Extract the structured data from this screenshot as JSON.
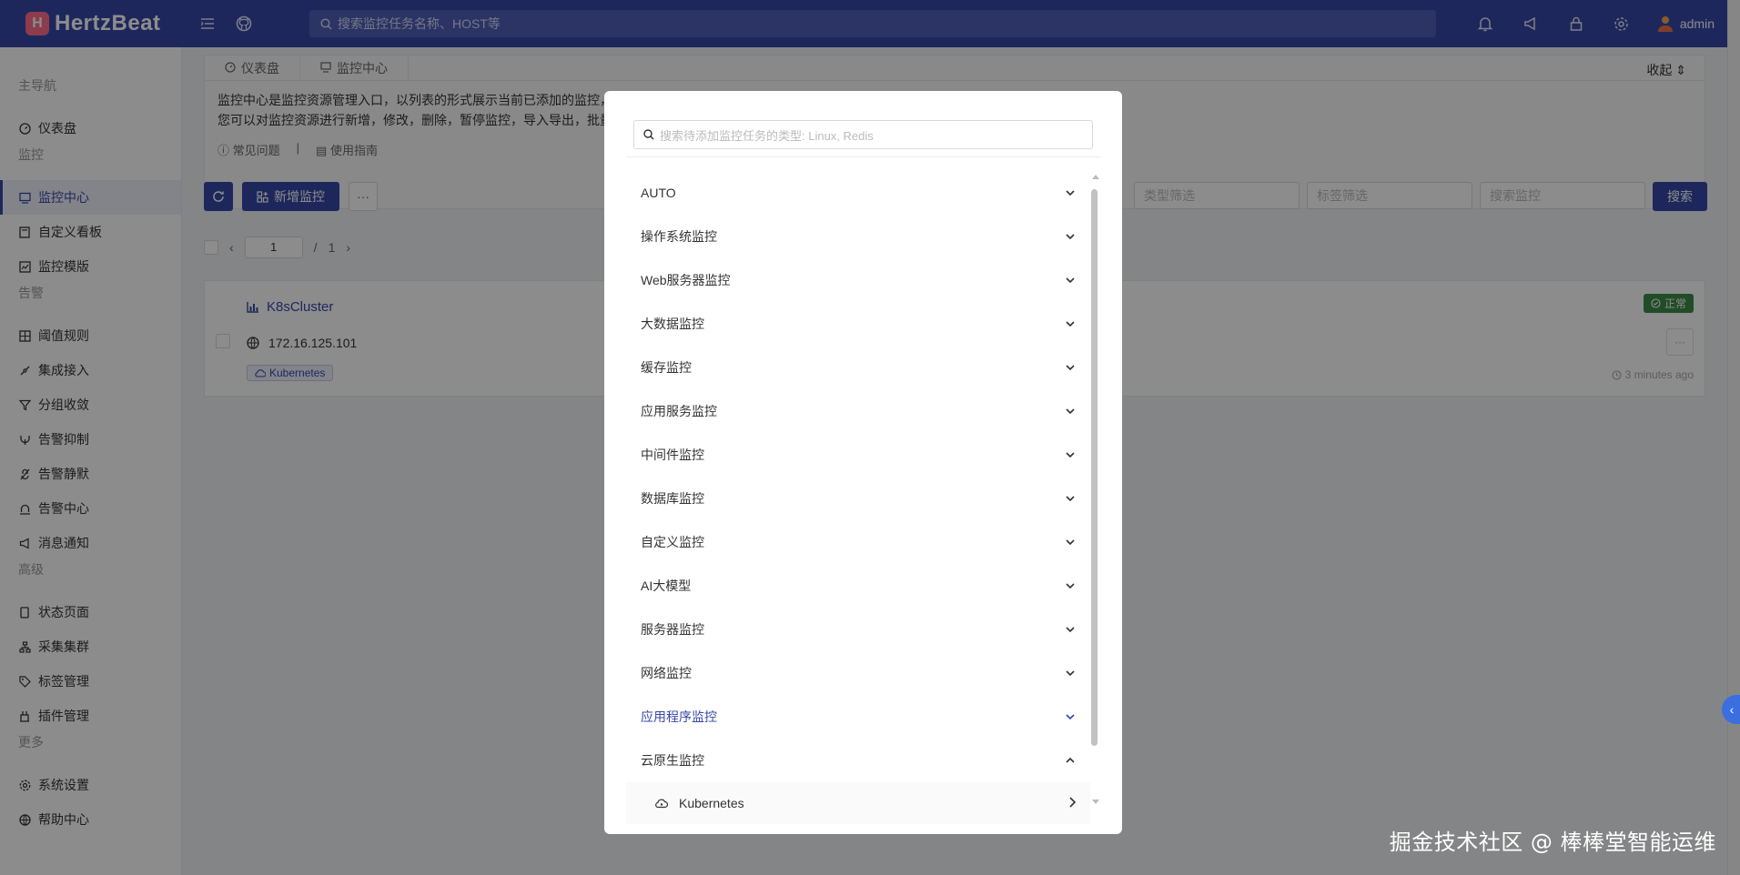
{
  "header": {
    "logo_mark": "H",
    "logo_text": "HertzBeat",
    "search_placeholder": "搜索监控任务名称、HOST等",
    "user": "admin"
  },
  "sidebar": {
    "groups": [
      {
        "label": "主导航",
        "items": [
          {
            "label": "仪表盘",
            "icon": "dashboard-icon"
          }
        ]
      },
      {
        "label": "监控",
        "items": [
          {
            "label": "监控中心",
            "icon": "monitor-icon",
            "active": true
          },
          {
            "label": "自定义看板",
            "icon": "board-icon"
          },
          {
            "label": "监控模版",
            "icon": "template-icon"
          }
        ]
      },
      {
        "label": "告警",
        "items": [
          {
            "label": "阈值规则",
            "icon": "threshold-icon"
          },
          {
            "label": "集成接入",
            "icon": "integration-icon"
          },
          {
            "label": "分组收敛",
            "icon": "group-icon"
          },
          {
            "label": "告警抑制",
            "icon": "inhibit-icon"
          },
          {
            "label": "告警静默",
            "icon": "silence-icon"
          },
          {
            "label": "告警中心",
            "icon": "alert-center-icon"
          },
          {
            "label": "消息通知",
            "icon": "notification-icon"
          }
        ]
      },
      {
        "label": "高级",
        "items": [
          {
            "label": "状态页面",
            "icon": "status-page-icon"
          },
          {
            "label": "采集集群",
            "icon": "collector-icon"
          },
          {
            "label": "标签管理",
            "icon": "tag-icon"
          },
          {
            "label": "插件管理",
            "icon": "plugin-icon"
          }
        ]
      },
      {
        "label": "更多",
        "items": [
          {
            "label": "系统设置",
            "icon": "settings-icon"
          },
          {
            "label": "帮助中心",
            "icon": "help-icon"
          }
        ]
      }
    ]
  },
  "main": {
    "tabs": [
      "仪表盘",
      "监控中心"
    ],
    "collapse_label": "收起",
    "info_line1": "监控中心是监控资源管理入口，以列表的形式展示当前已添加的监控，",
    "info_line2": "您可以对监控资源进行新增，修改，删除，暂停监控，导入导出，批量",
    "faq_link": "常见问题",
    "guide_link": "使用指南",
    "add_button": "新增监控",
    "more_button": "···",
    "filters": {
      "type_placeholder": "类型筛选",
      "tag_placeholder": "标签筛选",
      "search_placeholder": "搜索监控",
      "search_button": "搜索"
    },
    "pager": {
      "current": "1",
      "separator": "/",
      "total": "1"
    },
    "monitor": {
      "name": "K8sCluster",
      "host": "172.16.125.101",
      "tag": "Kubernetes",
      "status": "正常",
      "more": "···",
      "updated": "3 minutes ago"
    }
  },
  "modal": {
    "search_placeholder": "搜索待添加监控任务的类型: Linux, Redis",
    "categories": [
      {
        "label": "AUTO",
        "expanded": false
      },
      {
        "label": "操作系统监控",
        "expanded": false
      },
      {
        "label": "Web服务器监控",
        "expanded": false
      },
      {
        "label": "大数据监控",
        "expanded": false
      },
      {
        "label": "缓存监控",
        "expanded": false
      },
      {
        "label": "应用服务监控",
        "expanded": false
      },
      {
        "label": "中间件监控",
        "expanded": false
      },
      {
        "label": "数据库监控",
        "expanded": false
      },
      {
        "label": "自定义监控",
        "expanded": false
      },
      {
        "label": "AI大模型",
        "expanded": false
      },
      {
        "label": "服务器监控",
        "expanded": false
      },
      {
        "label": "网络监控",
        "expanded": false
      },
      {
        "label": "应用程序监控",
        "expanded": false,
        "highlight": true
      },
      {
        "label": "云原生监控",
        "expanded": true
      }
    ],
    "sub_item": "Kubernetes"
  },
  "watermark": "掘金技术社区 @ 棒棒堂智能运维",
  "colors": {
    "primary": "#3747a8",
    "success": "#3c8b4a",
    "toggle": "#3b6fe0"
  }
}
